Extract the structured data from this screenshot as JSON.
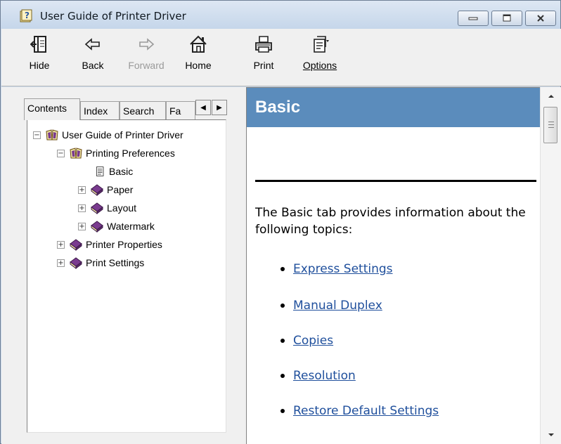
{
  "window": {
    "title": "User Guide of Printer Driver"
  },
  "toolbar": {
    "hide": "Hide",
    "back": "Back",
    "forward": "Forward",
    "home": "Home",
    "print": "Print",
    "options": "Options"
  },
  "tabs": {
    "contents": "Contents",
    "index": "Index",
    "search": "Search",
    "favorites_truncated": "Fa"
  },
  "tree": {
    "root": "User Guide of Printer Driver",
    "printing_preferences": "Printing Preferences",
    "basic": "Basic",
    "paper": "Paper",
    "layout": "Layout",
    "watermark": "Watermark",
    "printer_properties": "Printer Properties",
    "print_settings": "Print Settings"
  },
  "content": {
    "heading": "Basic",
    "intro": "The Basic tab provides information about the following topics:",
    "topics": [
      "Express Settings",
      "Manual Duplex",
      "Copies",
      "Resolution",
      "Restore Default Settings"
    ]
  },
  "colors": {
    "heading_bar": "#5b8cbc",
    "link": "#1f4f9c",
    "book_icon": "#7a3b8f"
  }
}
